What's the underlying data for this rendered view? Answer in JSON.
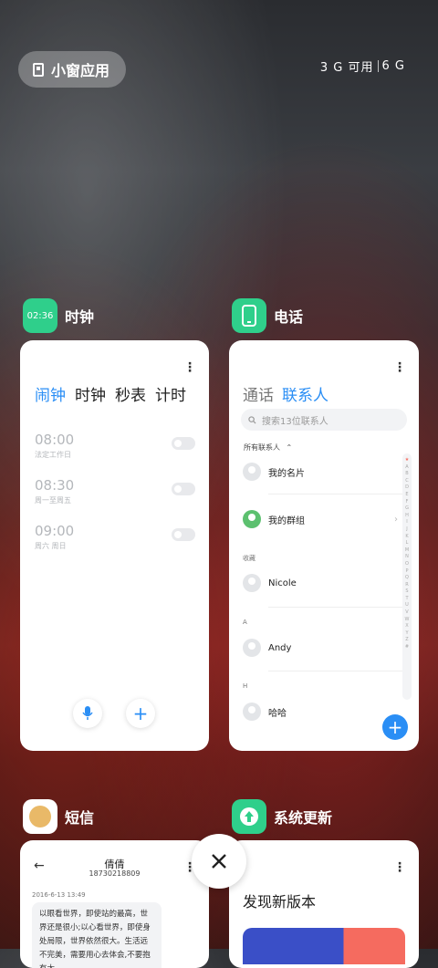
{
  "top": {
    "small_window_label": "小窗应用",
    "memory_available": "3 G 可用",
    "memory_total": "6 G"
  },
  "clock": {
    "app_name": "时钟",
    "icon_text": "02:36",
    "icon_color": "#2fcf8b",
    "tabs": [
      "闹钟",
      "时钟",
      "秒表",
      "计时"
    ],
    "alarms": [
      {
        "time": "08:00",
        "repeat": "法定工作日"
      },
      {
        "time": "08:30",
        "repeat": "周一至周五"
      },
      {
        "time": "09:00",
        "repeat": "周六 周日"
      }
    ]
  },
  "phone": {
    "app_name": "电话",
    "icon_color": "#2fcf8b",
    "tabs": [
      "通话",
      "联系人"
    ],
    "search_placeholder": "搜索13位联系人",
    "filter_label": "所有联系人",
    "my_card": "我的名片",
    "my_groups": "我的群组",
    "sections": [
      {
        "header": "收藏",
        "name": "Nicole"
      },
      {
        "header": "A",
        "name": "Andy"
      },
      {
        "header": "H",
        "name": "哈哈"
      }
    ],
    "index": [
      "★",
      "A",
      "B",
      "C",
      "D",
      "E",
      "F",
      "G",
      "H",
      "I",
      "J",
      "K",
      "L",
      "M",
      "N",
      "O",
      "P",
      "Q",
      "R",
      "S",
      "T",
      "U",
      "V",
      "W",
      "X",
      "Y",
      "Z",
      "#"
    ]
  },
  "sms": {
    "app_name": "短信",
    "contact_name": "倩倩",
    "contact_number": "18730218809",
    "date": "2016-6-13 13:49",
    "message": "以眼看世界，即使站的最高，世界还是很小;以心看世界，即使身处局限，世界依然很大。生活远不完美，需要用心去体会,不要抱有太"
  },
  "update": {
    "app_name": "系统更新",
    "icon_color": "#2fcf8b",
    "headline": "发现新版本"
  }
}
